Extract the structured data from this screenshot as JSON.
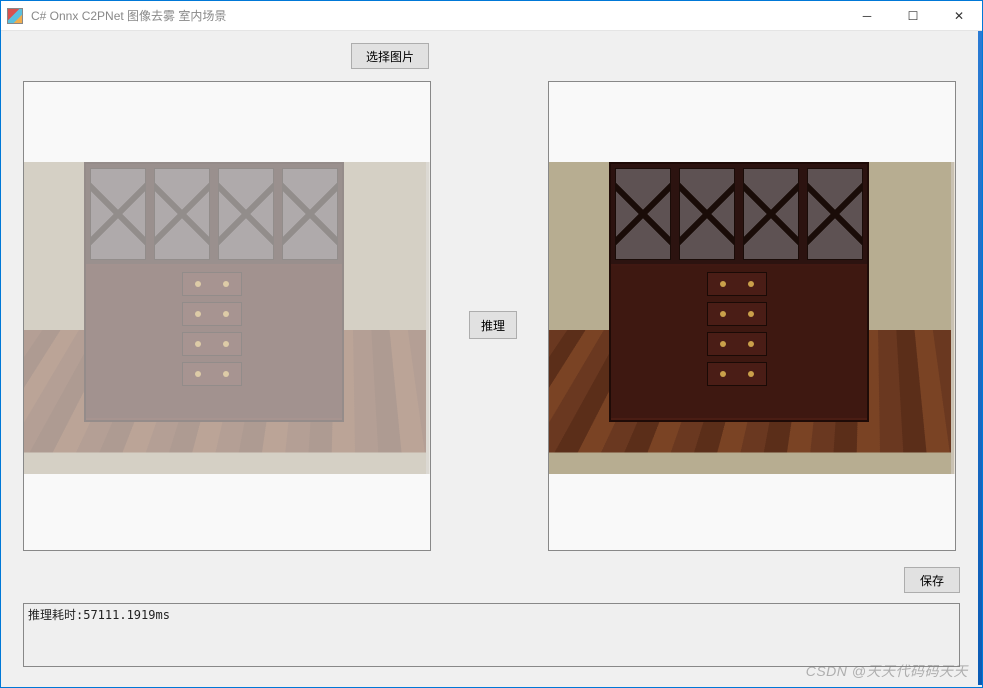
{
  "window": {
    "title": "C# Onnx C2PNet 图像去雾 室内场景"
  },
  "buttons": {
    "select_image": "选择图片",
    "infer": "推理",
    "save": "保存"
  },
  "log": {
    "text": "推理耗时:57111.1919ms"
  },
  "watermark": "CSDN @天天代码码天天"
}
